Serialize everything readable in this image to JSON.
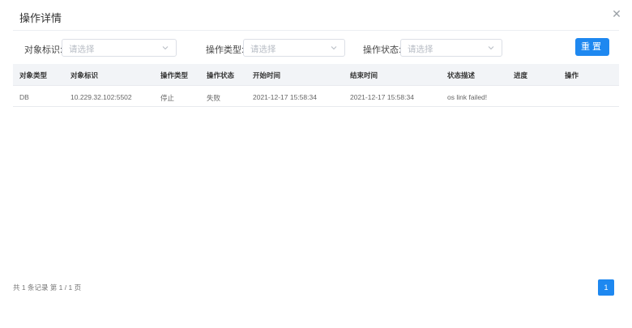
{
  "dialog": {
    "title": "操作详情"
  },
  "filters": {
    "object_id_label": "对象标识:",
    "object_id_placeholder": "请选择",
    "op_type_label": "操作类型:",
    "op_type_placeholder": "请选择",
    "op_status_label": "操作状态:",
    "op_status_placeholder": "请选择",
    "reset_label": "重置"
  },
  "table": {
    "headers": [
      "对象类型",
      "对象标识",
      "操作类型",
      "操作状态",
      "开始时间",
      "结束时间",
      "状态描述",
      "进度",
      "操作"
    ],
    "rows": [
      [
        "DB",
        "10.229.32.102:5502",
        "停止",
        "失败",
        "2021-12-17 15:58:34",
        "2021-12-17 15:58:34",
        "os link failed!",
        "",
        ""
      ]
    ]
  },
  "pagination": {
    "summary": "共 1 条记录  第 1 / 1 页",
    "current_page": "1"
  },
  "colors": {
    "primary": "#1e88f0",
    "header_bg": "#f2f4f7",
    "border": "#dcdfe6"
  }
}
